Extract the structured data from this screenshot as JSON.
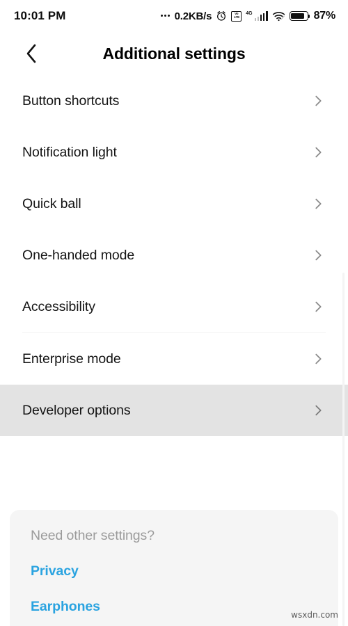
{
  "statusbar": {
    "clock": "10:01 PM",
    "network_speed": "0.2KB/s",
    "alarm_icon": "alarm-icon",
    "volte_line1": "Vo",
    "volte_line2": "LTE",
    "signal_generation": "4G",
    "wifi_icon": "wifi-icon",
    "battery_percent": "87%",
    "battery_level": 87
  },
  "appbar": {
    "back_icon": "back-chevron-icon",
    "title": "Additional settings"
  },
  "list": {
    "group1": [
      {
        "label": "Button shortcuts",
        "pressed": false
      },
      {
        "label": "Notification light",
        "pressed": false
      },
      {
        "label": "Quick ball",
        "pressed": false
      },
      {
        "label": "One-handed mode",
        "pressed": false
      },
      {
        "label": "Accessibility",
        "pressed": false
      }
    ],
    "group2": [
      {
        "label": "Enterprise mode",
        "pressed": false
      },
      {
        "label": "Developer options",
        "pressed": true
      }
    ]
  },
  "footer": {
    "heading": "Need other settings?",
    "links": [
      {
        "label": "Privacy"
      },
      {
        "label": "Earphones"
      }
    ]
  },
  "watermark": "wsxdn.com",
  "colors": {
    "link_blue": "#2aa3e0",
    "pressed_row": "#e3e3e3",
    "card_bg": "#f5f5f5",
    "divider": "#f1f1f1",
    "chevron": "#8a8a8a",
    "muted_text": "#9b9b9b"
  }
}
